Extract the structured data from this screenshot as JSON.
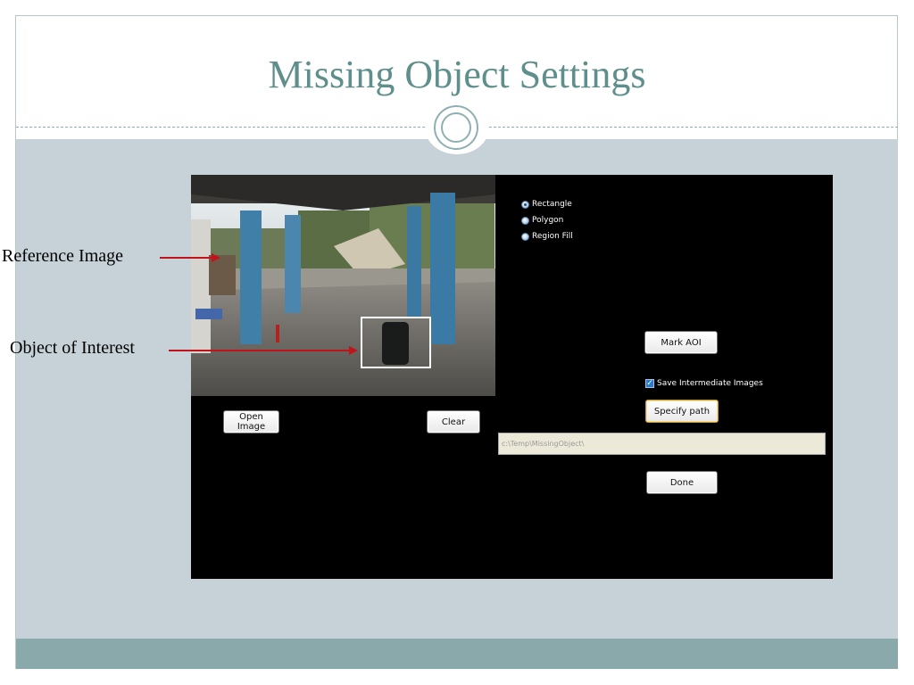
{
  "slide": {
    "title": "Missing Object Settings"
  },
  "annotations": {
    "reference_image": "Reference Image",
    "object_of_interest": "Object of Interest"
  },
  "app": {
    "shape_options": [
      {
        "label": "Rectangle",
        "checked": true
      },
      {
        "label": "Polygon",
        "checked": false
      },
      {
        "label": "Region Fill",
        "checked": false
      }
    ],
    "buttons": {
      "open_image": "Open Image",
      "clear": "Clear",
      "mark_aoi": "Mark AOI",
      "specify_path": "Specify path",
      "done": "Done"
    },
    "save_intermediate": {
      "label": "Save Intermediate Images",
      "checked": true
    },
    "output_path": {
      "value": "c:\\Temp\\MissingObject\\"
    }
  },
  "colors": {
    "title": "#5f8f8c",
    "content_bg": "#c6d2d8",
    "footer_bar": "#8aa9aa",
    "app_bg": "#000000",
    "arrow": "#c0141a"
  },
  "icons": {
    "slide_ornament": "double-ring-icon",
    "radio": "radio-button-icon",
    "checkbox": "checkmark-icon"
  }
}
